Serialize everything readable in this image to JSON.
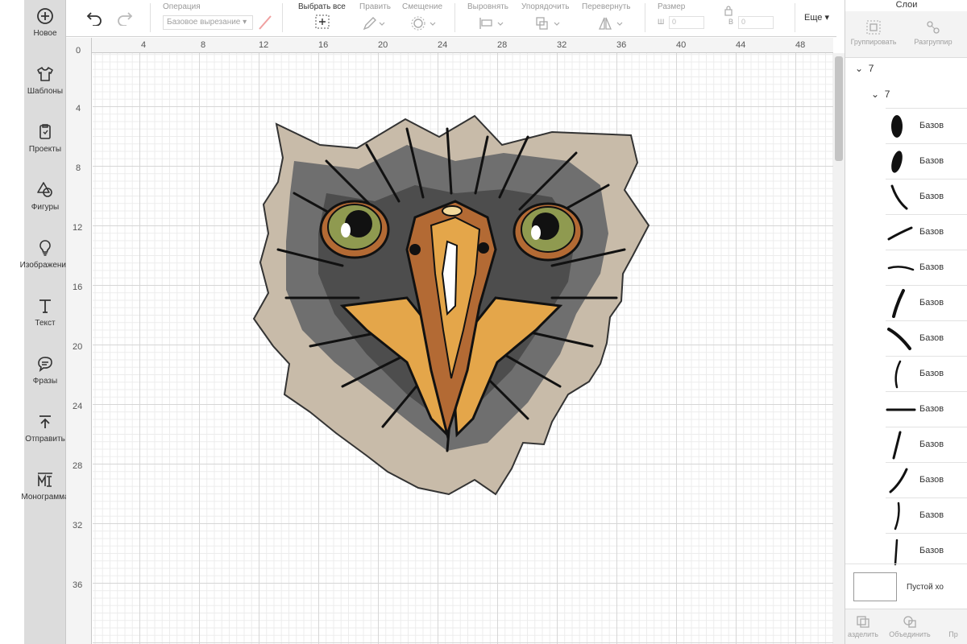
{
  "sidebar": {
    "items": [
      {
        "label": "Новое",
        "icon": "plus-circle-icon"
      },
      {
        "label": "Шаблоны",
        "icon": "tshirt-icon"
      },
      {
        "label": "Проекты",
        "icon": "projects-icon"
      },
      {
        "label": "Фигуры",
        "icon": "shapes-icon"
      },
      {
        "label": "Изображения",
        "icon": "lightbulb-icon"
      },
      {
        "label": "Текст",
        "icon": "text-icon"
      },
      {
        "label": "Фразы",
        "icon": "speech-bubble-icon"
      },
      {
        "label": "Отправить",
        "icon": "upload-icon"
      },
      {
        "label": "Монограмма",
        "icon": "monogram-icon"
      }
    ]
  },
  "toolbar": {
    "operation_label": "Операция",
    "operation_value": "Базовое вырезание",
    "select_all": "Выбрать все",
    "edit": "Править",
    "offset": "Смещение",
    "align": "Выровнять",
    "arrange": "Упорядочить",
    "flip": "Перевернуть",
    "size": "Размер",
    "width_letter": "Ш",
    "height_letter": "В",
    "width_value": "0",
    "height_value": "0",
    "more": "Еще"
  },
  "ruler": {
    "top": [
      "0",
      "4",
      "8",
      "12",
      "16",
      "20",
      "24",
      "28",
      "32",
      "36",
      "40",
      "44",
      "48"
    ],
    "left": [
      "0",
      "4",
      "8",
      "12",
      "16",
      "20",
      "24",
      "28",
      "32",
      "36"
    ]
  },
  "layers_panel": {
    "title": "Слои",
    "group_button": "Группировать",
    "ungroup_button": "Разгруппир",
    "group_name": "7",
    "subgroup_name": "7",
    "layer_label": "Базов",
    "layer_count": 13,
    "empty_label": "Пустой хо",
    "footer": {
      "slice": "азделить",
      "combine": "Объединить",
      "more": "Пр"
    }
  },
  "colors": {
    "sidebar_bg": "#dcdcdc",
    "eagle_backdrop": "#c8bba9",
    "feather_gray": "#6f6f6f",
    "beak_orange": "#e4a64a",
    "beak_dark": "#b36a34",
    "eye_green": "#8f9a50"
  }
}
